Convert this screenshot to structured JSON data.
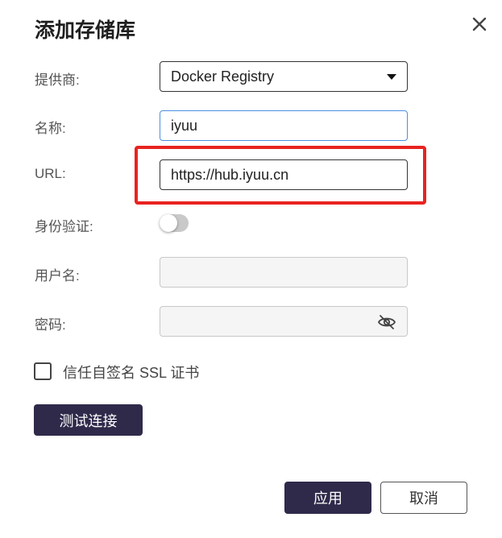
{
  "dialog": {
    "title": "添加存储库",
    "close_icon": "close-icon"
  },
  "form": {
    "provider": {
      "label": "提供商:",
      "value": "Docker Registry"
    },
    "name": {
      "label": "名称:",
      "value": "iyuu"
    },
    "url": {
      "label": "URL:",
      "value": "https://hub.iyuu.cn"
    },
    "auth": {
      "label": "身份验证:",
      "enabled": false
    },
    "username": {
      "label": "用户名:",
      "value": ""
    },
    "password": {
      "label": "密码:",
      "value": "",
      "toggle_icon": "eye-off-icon"
    },
    "trust_ssl": {
      "label": "信任自签名 SSL 证书",
      "checked": false
    }
  },
  "buttons": {
    "test": "测试连接",
    "apply": "应用",
    "cancel": "取消"
  },
  "colors": {
    "primary": "#2f2a4a",
    "highlight": "#e8231f",
    "focus_border": "#4a8fe0"
  }
}
